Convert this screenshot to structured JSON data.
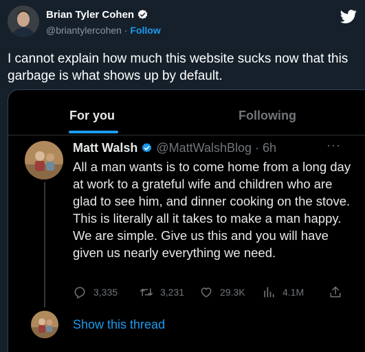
{
  "outer_tweet": {
    "author_name": "Brian Tyler Cohen",
    "author_handle": "@briantylercohen",
    "separator": "·",
    "follow_label": "Follow",
    "text": "I cannot explain how much this website sucks now that this garbage is what shows up by default."
  },
  "embedded": {
    "tabs": [
      {
        "label": "For you",
        "active": true
      },
      {
        "label": "Following",
        "active": false
      }
    ],
    "tweet": {
      "author_name": "Matt Walsh",
      "author_handle": "@MattWalshBlog",
      "separator": "·",
      "time": "6h",
      "more": "···",
      "text": "All a man wants is to come home from a long day at work to a grateful wife and children who are glad to see him, and dinner cooking on the stove. This is literally all it takes to make a man happy. We are simple. Give us this and you will have given us nearly everything we need.",
      "actions": {
        "replies": "3,335",
        "retweets": "3,231",
        "likes": "29.3K",
        "views": "4.1M"
      },
      "show_thread": "Show this thread"
    }
  },
  "colors": {
    "background": "#15202b",
    "card_background": "#000000",
    "accent": "#1d9bf0",
    "muted": "#71767b"
  },
  "icons": [
    "verified-badge-icon",
    "twitter-bird-icon",
    "more-icon",
    "reply-icon",
    "retweet-icon",
    "like-icon",
    "views-icon",
    "share-icon"
  ]
}
